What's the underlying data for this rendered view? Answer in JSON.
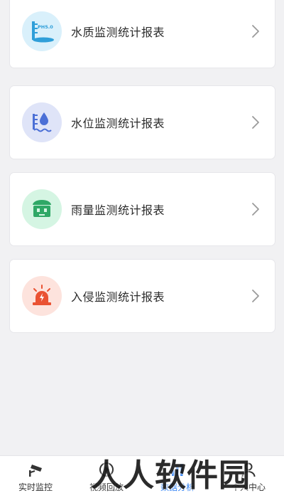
{
  "reports": [
    {
      "label": "水质监测统计报表",
      "icon": "water-quality-icon",
      "icon_text": "PH5.0",
      "bg": "#d9f0fb",
      "fg": "#2f9fd9"
    },
    {
      "label": "水位监测统计报表",
      "icon": "water-level-icon",
      "bg": "#dfe4f8",
      "fg": "#4b6fd6"
    },
    {
      "label": "雨量监测统计报表",
      "icon": "rainfall-icon",
      "bg": "#d5f5e3",
      "fg": "#2fa866"
    },
    {
      "label": "入侵监测统计报表",
      "icon": "intrusion-alarm-icon",
      "bg": "#fde3dd",
      "fg": "#ea5233"
    }
  ],
  "tabbar": {
    "tabs": [
      {
        "label": "实时监控",
        "icon": "cctv-camera-icon"
      },
      {
        "label": "视频回放",
        "icon": "video-playback-icon"
      },
      {
        "label": "数据分析",
        "icon": "data-analysis-icon",
        "active": true
      },
      {
        "label": "个人中心",
        "icon": "profile-icon"
      }
    ],
    "active_color": "#2a7df3"
  },
  "watermark": "人人软件园"
}
